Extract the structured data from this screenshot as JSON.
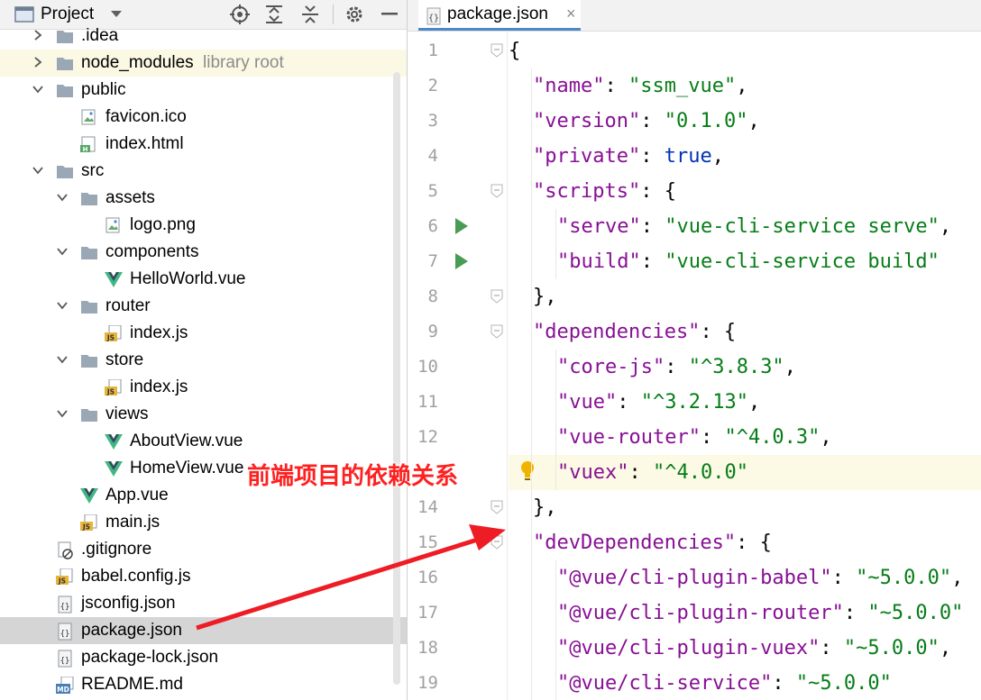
{
  "project_panel": {
    "title": "Project",
    "toolbar_icons": [
      "locate-icon",
      "expand-all-icon",
      "collapse-all-icon",
      "gear-icon",
      "hide-icon"
    ],
    "tree": [
      {
        "label": "_idea",
        "display": ".idea",
        "type": "folder",
        "expanded": false,
        "depth": 0
      },
      {
        "label": "node_modules",
        "type": "folder",
        "expanded": false,
        "depth": 0,
        "note": "library root"
      },
      {
        "label": "public",
        "type": "folder",
        "expanded": true,
        "depth": 0
      },
      {
        "label": "favicon.ico",
        "type": "image",
        "depth": 1
      },
      {
        "label": "index.html",
        "type": "html",
        "depth": 1
      },
      {
        "label": "src",
        "type": "folder",
        "expanded": true,
        "depth": 0
      },
      {
        "label": "assets",
        "type": "folder",
        "expanded": true,
        "depth": 1
      },
      {
        "label": "logo.png",
        "type": "image",
        "depth": 2
      },
      {
        "label": "components",
        "type": "folder",
        "expanded": true,
        "depth": 1
      },
      {
        "label": "HelloWorld.vue",
        "type": "vue",
        "depth": 2
      },
      {
        "label": "router",
        "type": "folder",
        "expanded": true,
        "depth": 1
      },
      {
        "label": "index.js",
        "type": "js",
        "depth": 2
      },
      {
        "label": "store",
        "type": "folder",
        "expanded": true,
        "depth": 1
      },
      {
        "label": "index.js",
        "type": "js",
        "depth": 2
      },
      {
        "label": "views",
        "type": "folder",
        "expanded": true,
        "depth": 1
      },
      {
        "label": "AboutView.vue",
        "type": "vue",
        "depth": 2
      },
      {
        "label": "HomeView.vue",
        "type": "vue",
        "depth": 2
      },
      {
        "label": "App.vue",
        "type": "vue",
        "depth": 1
      },
      {
        "label": "main.js",
        "type": "js",
        "depth": 1
      },
      {
        "label": ".gitignore",
        "type": "ignore",
        "depth": 0
      },
      {
        "label": "babel.config.js",
        "type": "js",
        "depth": 0
      },
      {
        "label": "jsconfig.json",
        "type": "json",
        "depth": 0
      },
      {
        "label": "package.json",
        "type": "json",
        "depth": 0,
        "selected": true
      },
      {
        "label": "package-lock.json",
        "type": "json",
        "depth": 0
      },
      {
        "label": "README.md",
        "type": "md",
        "depth": 0
      }
    ]
  },
  "editor": {
    "tab_label": "package.json",
    "tab_close": "×",
    "lines": [
      {
        "n": "1",
        "indent": 0,
        "tokens": [
          [
            "p",
            "{"
          ]
        ],
        "fold": true
      },
      {
        "n": "2",
        "indent": 1,
        "tokens": [
          [
            "k",
            "\"name\""
          ],
          [
            "p",
            ": "
          ],
          [
            "s",
            "\"ssm_vue\""
          ],
          [
            "p",
            ","
          ]
        ]
      },
      {
        "n": "3",
        "indent": 1,
        "tokens": [
          [
            "k",
            "\"version\""
          ],
          [
            "p",
            ": "
          ],
          [
            "s",
            "\"0.1.0\""
          ],
          [
            "p",
            ","
          ]
        ]
      },
      {
        "n": "4",
        "indent": 1,
        "tokens": [
          [
            "k",
            "\"private\""
          ],
          [
            "p",
            ": "
          ],
          [
            "b",
            "true"
          ],
          [
            "p",
            ","
          ]
        ]
      },
      {
        "n": "5",
        "indent": 1,
        "tokens": [
          [
            "k",
            "\"scripts\""
          ],
          [
            "p",
            ": {"
          ]
        ],
        "fold": true
      },
      {
        "n": "6",
        "indent": 2,
        "tokens": [
          [
            "k",
            "\"serve\""
          ],
          [
            "p",
            ": "
          ],
          [
            "s",
            "\"vue-cli-service serve\""
          ],
          [
            "p",
            ","
          ]
        ],
        "run": true
      },
      {
        "n": "7",
        "indent": 2,
        "tokens": [
          [
            "k",
            "\"build\""
          ],
          [
            "p",
            ": "
          ],
          [
            "s",
            "\"vue-cli-service build\""
          ]
        ],
        "run": true
      },
      {
        "n": "8",
        "indent": 1,
        "tokens": [
          [
            "p",
            "},"
          ]
        ],
        "fold": true
      },
      {
        "n": "9",
        "indent": 1,
        "tokens": [
          [
            "k",
            "\"dependencies\""
          ],
          [
            "p",
            ": {"
          ]
        ],
        "fold": true
      },
      {
        "n": "10",
        "indent": 2,
        "tokens": [
          [
            "k",
            "\"core-js\""
          ],
          [
            "p",
            ": "
          ],
          [
            "s",
            "\"^3.8.3\""
          ],
          [
            "p",
            ","
          ]
        ]
      },
      {
        "n": "11",
        "indent": 2,
        "tokens": [
          [
            "k",
            "\"vue\""
          ],
          [
            "p",
            ": "
          ],
          [
            "s",
            "\"^3.2.13\""
          ],
          [
            "p",
            ","
          ]
        ]
      },
      {
        "n": "12",
        "indent": 2,
        "tokens": [
          [
            "k",
            "\"vue-router\""
          ],
          [
            "p",
            ": "
          ],
          [
            "s",
            "\"^4.0.3\""
          ],
          [
            "p",
            ","
          ]
        ]
      },
      {
        "n": "",
        "indent": 2,
        "tokens": [
          [
            "k",
            "\"vuex\""
          ],
          [
            "p",
            ": "
          ],
          [
            "s",
            "\"^4.0.0\""
          ]
        ],
        "highlight": true,
        "bulb": true
      },
      {
        "n": "14",
        "indent": 1,
        "tokens": [
          [
            "p",
            "},"
          ]
        ],
        "fold": true
      },
      {
        "n": "15",
        "indent": 1,
        "tokens": [
          [
            "k",
            "\"devDependencies\""
          ],
          [
            "p",
            ": {"
          ]
        ],
        "fold": true
      },
      {
        "n": "16",
        "indent": 2,
        "tokens": [
          [
            "k",
            "\"@vue/cli-plugin-babel\""
          ],
          [
            "p",
            ": "
          ],
          [
            "s",
            "\"~5.0.0\""
          ],
          [
            "p",
            ","
          ]
        ]
      },
      {
        "n": "17",
        "indent": 2,
        "tokens": [
          [
            "k",
            "\"@vue/cli-plugin-router\""
          ],
          [
            "p",
            ": "
          ],
          [
            "s",
            "\"~5.0.0\""
          ]
        ]
      },
      {
        "n": "18",
        "indent": 2,
        "tokens": [
          [
            "k",
            "\"@vue/cli-plugin-vuex\""
          ],
          [
            "p",
            ": "
          ],
          [
            "s",
            "\"~5.0.0\""
          ],
          [
            "p",
            ","
          ]
        ]
      },
      {
        "n": "19",
        "indent": 2,
        "tokens": [
          [
            "k",
            "\"@vue/cli-service\""
          ],
          [
            "p",
            ": "
          ],
          [
            "s",
            "\"~5.0.0\""
          ]
        ]
      }
    ]
  },
  "annotation": {
    "text": "前端项目的依赖关系",
    "color": "#ff2020"
  }
}
